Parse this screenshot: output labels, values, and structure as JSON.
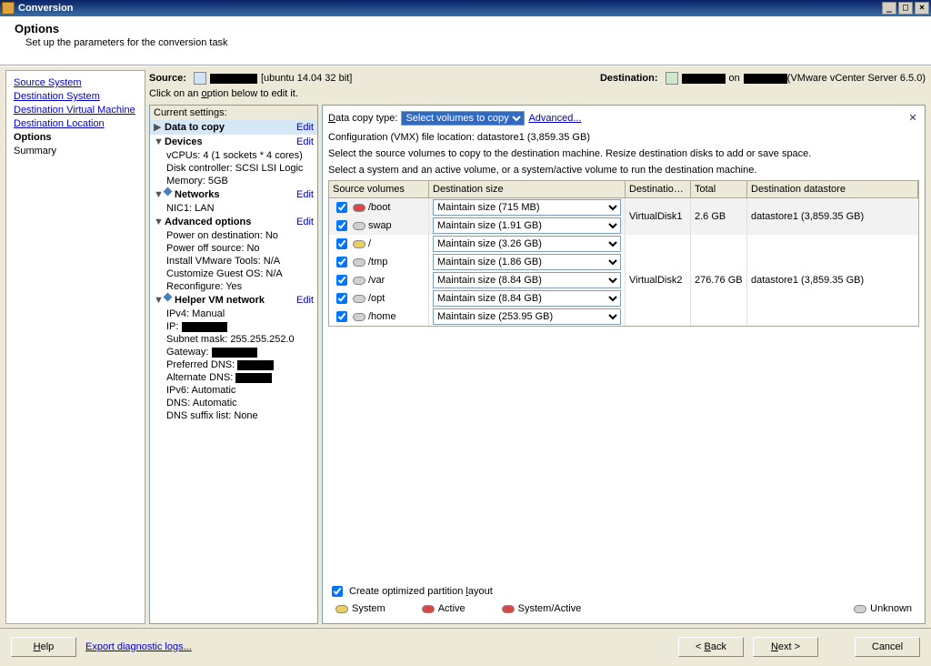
{
  "window": {
    "title": "Conversion"
  },
  "header": {
    "title": "Options",
    "subtitle": "Set up the parameters for the conversion task"
  },
  "nav": {
    "items": [
      {
        "label": "Source System",
        "type": "link"
      },
      {
        "label": "Destination System",
        "type": "link"
      },
      {
        "label": "Destination Virtual Machine",
        "type": "link"
      },
      {
        "label": "Destination Location",
        "type": "link"
      },
      {
        "label": "Options",
        "type": "current"
      },
      {
        "label": "Summary",
        "type": "plain"
      }
    ]
  },
  "srcdest": {
    "source_label": "Source:",
    "source_info": "[ubuntu 14.04 32 bit]",
    "dest_label": "Destination:",
    "dest_on": "on",
    "dest_info": "(VMware vCenter Server 6.5.0)",
    "hint_prefix": "Click on an ",
    "hint_o": "o",
    "hint_suffix": "ption below to edit it."
  },
  "settings": {
    "title": "Current settings:",
    "edit": "Edit",
    "data_to_copy": "Data to copy",
    "devices": "Devices",
    "devices_items": [
      "vCPUs: 4 (1 sockets * 4 cores)",
      "Disk controller: SCSI LSI Logic",
      "Memory: 5GB"
    ],
    "networks": "Networks",
    "networks_items": [
      "NIC1: LAN"
    ],
    "advanced": "Advanced options",
    "advanced_items": [
      "Power on destination: No",
      "Power off source: No",
      "Install VMware Tools: N/A",
      "Customize Guest OS: N/A",
      "Reconfigure: Yes"
    ],
    "helper": "Helper VM network",
    "helper_items": [
      "IPv4: Manual",
      "IP:",
      "Subnet mask: 255.255.252.0",
      "Gateway:",
      "Preferred DNS:",
      "Alternate DNS:",
      "IPv6: Automatic",
      "DNS: Automatic",
      "DNS suffix list: None"
    ]
  },
  "detail": {
    "copy_type_label_d": "D",
    "copy_type_label": "ata copy type:",
    "copy_type_value": "Select volumes to copy",
    "advanced_link": "Advanced...",
    "vmx_line": "Configuration (VMX) file location: datastore1 (3,859.35 GB)",
    "desc1": "Select the source volumes to copy to the destination machine. Resize destination disks to add or save space.",
    "desc2": "Select a system and an active volume, or a system/active volume to run the destination machine.",
    "columns": {
      "sv": "Source volumes",
      "ds": "Destination size",
      "dl": "Destinatio…",
      "tot": "Total",
      "dstore": "Destination datastore"
    },
    "groups": [
      {
        "rows": [
          {
            "name": "/boot",
            "icon": "red",
            "size": "Maintain size (715 MB)"
          },
          {
            "name": "swap",
            "icon": "gray",
            "size": "Maintain size (1.91 GB)"
          }
        ],
        "layout": "VirtualDisk1",
        "total": "2.6 GB",
        "datastore": "datastore1 (3,859.35 GB)",
        "shade": true
      },
      {
        "rows": [
          {
            "name": "/",
            "icon": "yellow",
            "size": "Maintain size (3.26 GB)"
          },
          {
            "name": "/tmp",
            "icon": "gray",
            "size": "Maintain size (1.86 GB)"
          },
          {
            "name": "/var",
            "icon": "gray",
            "size": "Maintain size (8.84 GB)"
          },
          {
            "name": "/opt",
            "icon": "gray",
            "size": "Maintain size (8.84 GB)"
          },
          {
            "name": "/home",
            "icon": "gray",
            "size": "Maintain size (253.95 GB)"
          }
        ],
        "layout": "VirtualDisk2",
        "total": "276.76 GB",
        "datastore": "datastore1 (3,859.35 GB)",
        "shade": false
      }
    ],
    "optimize_label_pre": "Create optimized partition ",
    "optimize_label_l": "l",
    "optimize_label_post": "ayout",
    "legend": {
      "system": "System",
      "active": "Active",
      "sysact": "System/Active",
      "unknown": "Unknown"
    }
  },
  "footer": {
    "help_h": "H",
    "help": "elp",
    "export": "Export diagnostic logs...",
    "back": "< Back",
    "back_b": "B",
    "next_n": "N",
    "next": "ext >",
    "cancel": "Cancel"
  }
}
